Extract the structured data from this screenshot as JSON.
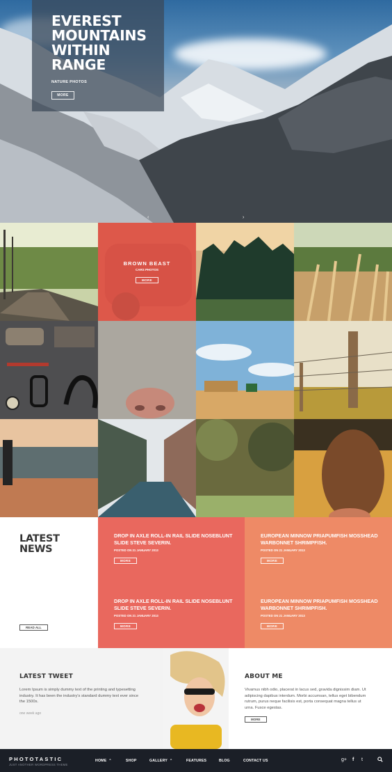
{
  "hero": {
    "title": "EVEREST MOUNTAINS WITHIN RANGE",
    "subtitle": "NATURE PHOTOS",
    "button": "MORE",
    "prev_icon": "‹",
    "next_icon": "›"
  },
  "gallery": {
    "featured": {
      "title": "BROWN BEAST",
      "subtitle": "CARS PHOTOS",
      "button": "MORE"
    },
    "tiles": [
      "railway-tracks",
      "red-vintage-car",
      "pine-forest",
      "wheat-field",
      "flatlay-accessories",
      "cat-nose",
      "hay-bales-tractor",
      "wire-fence",
      "man-by-sea",
      "city-street",
      "grass-closeup",
      "girl-hair-sunset"
    ]
  },
  "news": {
    "heading": "LATEST NEWS",
    "read_all": "READ ALL",
    "posts": [
      {
        "title": "DROP IN AXLE ROLL-IN RAIL SLIDE NOSEBLUNT SLIDE STEVE SEVERIN.",
        "date": "POSTED ON 21 JANUARY 2013",
        "button": "MORE"
      },
      {
        "title": "EUROPEAN MINNOW PRIAPUMFISH MOSSHEAD WARBONNET SHRIMPFISH.",
        "date": "POSTED ON 21 JANUARY 2013",
        "button": "MORE"
      },
      {
        "title": "DROP IN AXLE ROLL-IN RAIL SLIDE NOSEBLUNT SLIDE STEVE SEVERIN.",
        "date": "POSTED ON 21 JANUARY 2013",
        "button": "MORE"
      },
      {
        "title": "EUROPEAN MINNOW PRIAPUMFISH MOSSHEAD WARBONNET SHRIMPFISH.",
        "date": "POSTED ON 21 JANUARY 2013",
        "button": "MORE"
      }
    ]
  },
  "tweet": {
    "title": "LATEST TWEET",
    "text": "Lorem Ipsum is simply dummy text of the printing and typesetting industry. It has been the industry's standard dummy text ever since the 1500s.",
    "time": "one week ago"
  },
  "about": {
    "title": "ABOUT ME",
    "text": "Vivamus nibh odio, placerat in lacus sed, gravida dignissim diam. Ut adipiscing dapibus interdum. Morbi accumsan, tellus eget bibendum rutrum, purus neque facilisis est, porta consequat magna tellus ut urna. Fusce egestas.",
    "button": "MORE"
  },
  "footer": {
    "brand": "PHOTOTASTIC",
    "tagline": "JUST ANOTHER WORDPRESS THEME",
    "nav": [
      {
        "label": "HOME",
        "caret": "⌃"
      },
      {
        "label": "SHOP",
        "caret": ""
      },
      {
        "label": "GALLERY",
        "caret": "⌃"
      },
      {
        "label": "FEATURES",
        "caret": ""
      },
      {
        "label": "BLOG",
        "caret": ""
      },
      {
        "label": "CONTACT US",
        "caret": ""
      }
    ],
    "social": {
      "gplus": "g+",
      "facebook": "f",
      "twitter": "t"
    }
  },
  "colors": {
    "coral": "#e9685e",
    "orange": "#ee8a66",
    "footer": "#1b1f27",
    "panel": "#3c4858"
  }
}
